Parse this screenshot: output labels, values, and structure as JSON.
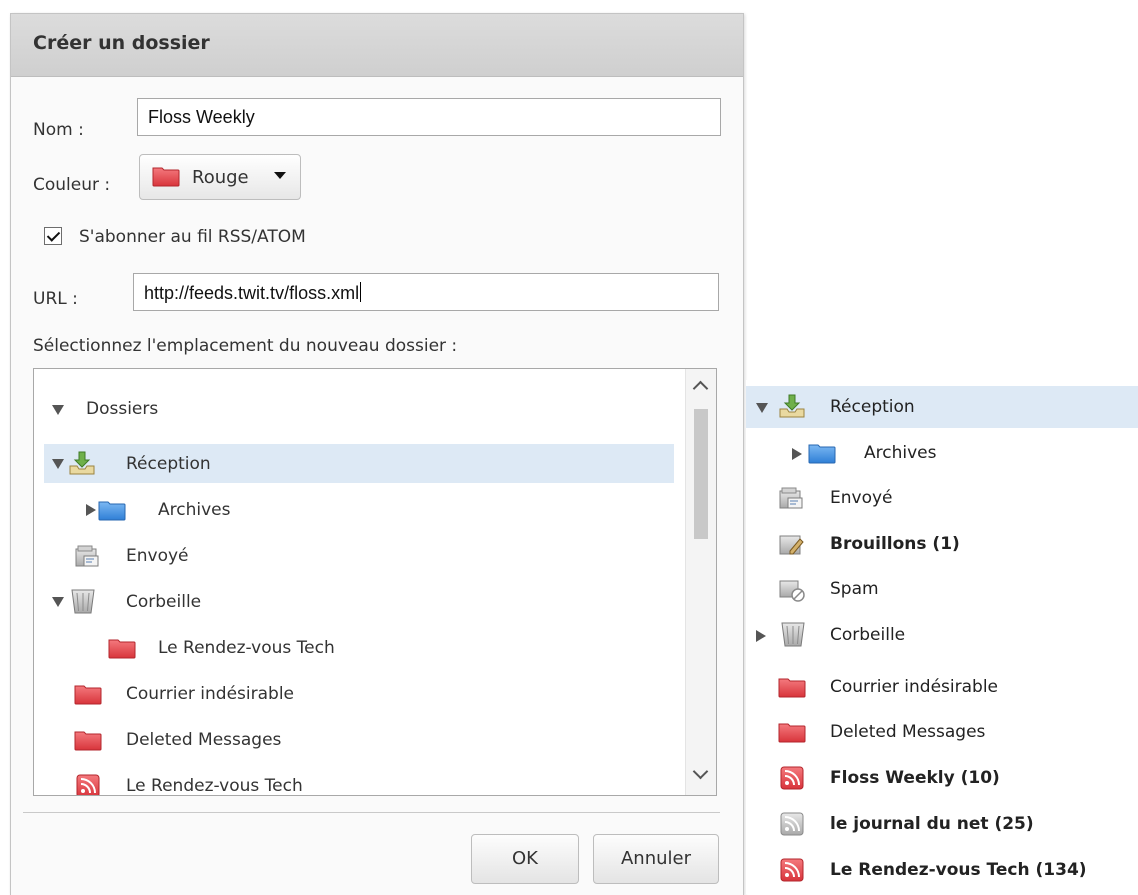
{
  "dialog": {
    "title": "Créer un dossier",
    "name_label": "Nom :",
    "name_value": "Floss Weekly",
    "color_label": "Couleur :",
    "color_value": "Rouge",
    "subscribe_label": "S'abonner au fil RSS/ATOM",
    "subscribe_checked": true,
    "url_label": "URL :",
    "url_value": "http://feeds.twit.tv/floss.xml",
    "location_label": "Sélectionnez l'emplacement du nouveau dossier :",
    "tree": {
      "root": "Dossiers",
      "items": [
        {
          "label": "Réception",
          "icon": "inbox-icon",
          "expanded": true,
          "selected": true
        },
        {
          "label": "Archives",
          "icon": "folder-blue-icon"
        },
        {
          "label": "Envoyé",
          "icon": "sent-icon"
        },
        {
          "label": "Corbeille",
          "icon": "trash-icon",
          "expanded": true
        },
        {
          "label": "Le Rendez-vous Tech",
          "icon": "folder-red-icon"
        },
        {
          "label": "Courrier indésirable",
          "icon": "folder-red-icon"
        },
        {
          "label": "Deleted Messages",
          "icon": "folder-red-icon"
        },
        {
          "label": "Le Rendez-vous Tech",
          "icon": "rss-red-icon"
        }
      ]
    },
    "ok_label": "OK",
    "cancel_label": "Annuler"
  },
  "side_panel": {
    "items": [
      {
        "label": "Réception",
        "icon": "inbox-icon",
        "selected": true
      },
      {
        "label": "Archives",
        "icon": "folder-blue-icon"
      },
      {
        "label": "Envoyé",
        "icon": "sent-icon"
      },
      {
        "label": "Brouillons (1)",
        "icon": "drafts-icon",
        "bold": true
      },
      {
        "label": "Spam",
        "icon": "spam-icon"
      },
      {
        "label": "Corbeille",
        "icon": "trash-icon"
      },
      {
        "label": "Courrier indésirable",
        "icon": "folder-red-icon"
      },
      {
        "label": "Deleted Messages",
        "icon": "folder-red-icon"
      },
      {
        "label": "Floss Weekly (10)",
        "icon": "rss-red-icon",
        "bold": true
      },
      {
        "label": "le journal du net (25)",
        "icon": "rss-gray-icon",
        "bold": true
      },
      {
        "label": "Le Rendez-vous Tech (134)",
        "icon": "rss-red-icon",
        "bold": true
      }
    ]
  },
  "colors": {
    "selection": "#dde9f5",
    "folder_red": "#e0474c",
    "folder_blue": "#3f8fe0"
  }
}
